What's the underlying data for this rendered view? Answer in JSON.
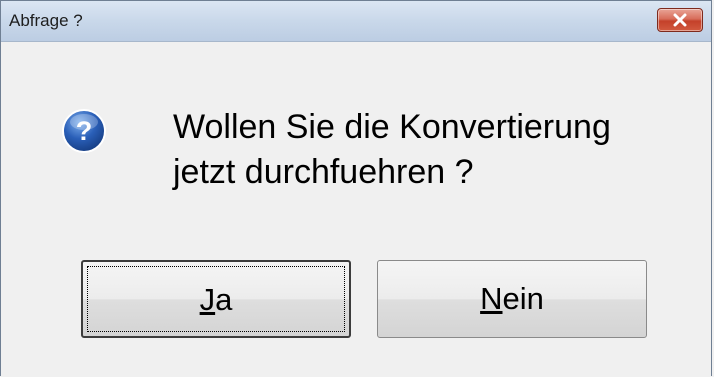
{
  "window": {
    "title": "Abfrage ?",
    "close_icon": "close-icon"
  },
  "dialog": {
    "icon": "question-icon",
    "message_line1": "Wollen Sie die Konvertierung",
    "message_line2": "jetzt durchfuehren ?"
  },
  "buttons": {
    "yes": {
      "mnemonic": "J",
      "rest": "a"
    },
    "no": {
      "mnemonic": "N",
      "rest": "ein"
    }
  },
  "colors": {
    "titlebar": "#c9d8ea",
    "close_button": "#c4412a",
    "icon_blue": "#2a5fb8",
    "dialog_background": "#f0f0f0"
  }
}
